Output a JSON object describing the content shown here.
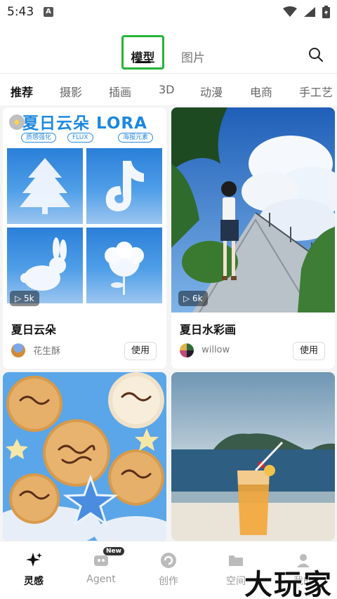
{
  "status_bar": {
    "time": "5:43",
    "notification": "A"
  },
  "header": {
    "tabs": [
      {
        "label": "模型"
      },
      {
        "label": "图片"
      }
    ]
  },
  "categories": [
    "推荐",
    "摄影",
    "插画",
    "3D",
    "动漫",
    "电商",
    "手工艺"
  ],
  "cards": [
    {
      "title": "夏日云朵",
      "author": "花生酥",
      "views": "5k",
      "use_label": "使用",
      "poster": {
        "title": "夏日云朵 LORA",
        "tags": [
          "质感强化",
          "FLUX",
          "海报元素"
        ]
      }
    },
    {
      "title": "夏日水彩画",
      "author": "willow",
      "views": "6k",
      "use_label": "使用"
    },
    {
      "title": "",
      "author": "",
      "views": "",
      "use_label": ""
    },
    {
      "title": "",
      "author": "",
      "views": "",
      "use_label": ""
    }
  ],
  "bottom_nav": [
    {
      "label": "灵感",
      "icon": "sparkle-icon"
    },
    {
      "label": "Agent",
      "icon": "agent-icon",
      "badge": "New"
    },
    {
      "label": "创作",
      "icon": "create-icon"
    },
    {
      "label": "空间",
      "icon": "folder-icon"
    },
    {
      "label": "我的",
      "icon": "profile-icon"
    }
  ],
  "watermark": "大玩家",
  "colors": {
    "accent_highlight": "#27b33a",
    "text_primary": "#111111"
  }
}
